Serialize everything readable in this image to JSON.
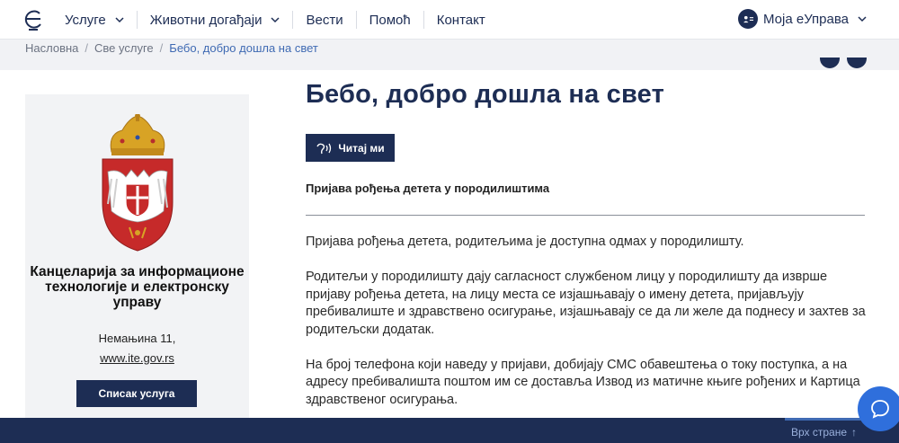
{
  "header": {
    "nav": [
      {
        "label": "Услуге",
        "dropdown": true
      },
      {
        "label": "Животни догађаји",
        "dropdown": true
      },
      {
        "label": "Вести",
        "dropdown": false
      },
      {
        "label": "Помоћ",
        "dropdown": false
      },
      {
        "label": "Контакт",
        "dropdown": false
      }
    ],
    "account_label": "Моја еУправа"
  },
  "breadcrumb": {
    "items": [
      "Насловна",
      "Све услуге",
      "Бебо, добро дошла на свет"
    ]
  },
  "sidebar": {
    "org_name": "Канцеларија за информационе технологије и електронску управу",
    "address": "Немањина 11,",
    "website": "www.ite.gov.rs",
    "services_button": "Списак услуга"
  },
  "main": {
    "title": "Бебо, добро дошла на свет",
    "read_button": "Читај ми",
    "subtitle": "Пријава рођења детета у породилиштима",
    "paragraphs": [
      "Пријава рођења детета, родитељима је доступна одмах у породилишту.",
      "Родитељи у породилишту дају сагласност службеном лицу у породилишту да изврше пријаву рођења детета, на лицу места се изјашњавају о имену детета, пријављују пребивалиште и здравствено осигурање, изјашњавају се да ли желе да поднесу и захтев за родитељски додатак.",
      "На број телефона који наведу у пријави, добијају СМС обавештења о току поступка, а на адресу пребивалишта поштом им се доставља Извод из матичне књиге рођених и Картица здравственог осигурања."
    ]
  },
  "footer": {
    "back_to_top": "Врх стране"
  },
  "colors": {
    "primary": "#1d2d54",
    "link": "#3f6ab3",
    "chat": "#2f6fdc",
    "sidebar_bg": "#f2f3f5"
  },
  "icons": {
    "logo": "e-logo-icon",
    "account": "user-id-icon",
    "read": "speaker-icon",
    "chat": "chat-bubble-icon",
    "back_to_top": "arrow-up-icon"
  }
}
